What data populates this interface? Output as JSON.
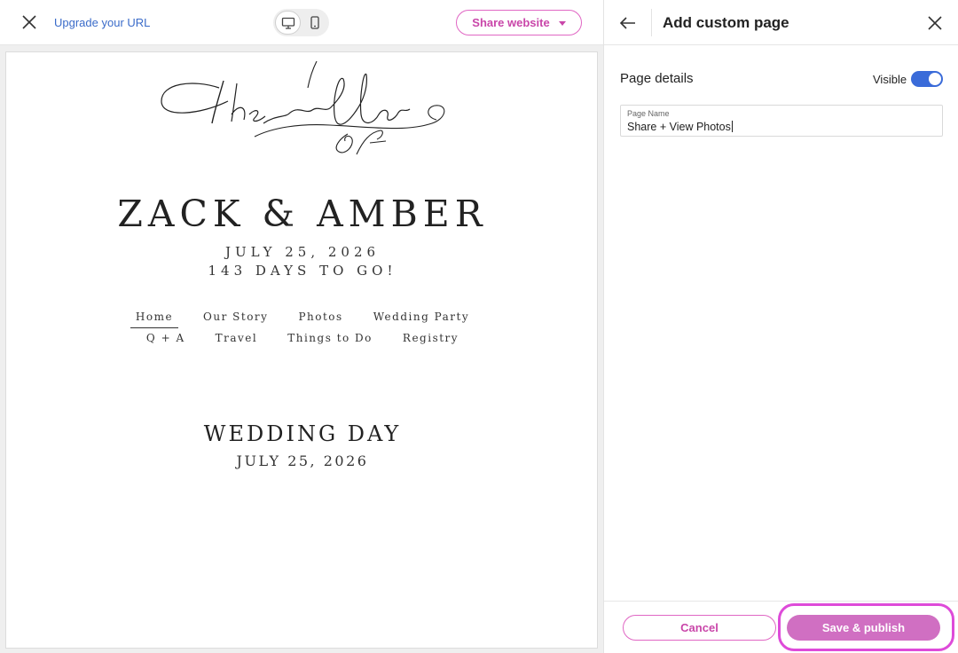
{
  "topbar": {
    "upgrade_link": "Upgrade your URL",
    "share_label": "Share website",
    "device_modes": [
      "desktop-icon",
      "mobile-icon"
    ],
    "accent_color": "#c946a9"
  },
  "preview": {
    "logo_text": "the wedding of",
    "couple": "ZACK & AMBER",
    "date": "JULY 25, 2026",
    "countdown": "143 DAYS TO GO!",
    "nav_row1": [
      "Home",
      "Our Story",
      "Photos",
      "Wedding Party"
    ],
    "nav_row2": [
      "Q + A",
      "Travel",
      "Things to Do",
      "Registry"
    ],
    "active_nav": "Home",
    "section_title": "WEDDING DAY",
    "section_date": "JULY 25, 2026"
  },
  "panel": {
    "title": "Add custom page",
    "section_label": "Page details",
    "visible_label": "Visible",
    "visible_on": true,
    "field_label": "Page Name",
    "field_value": "Share + View Photos",
    "cancel_label": "Cancel",
    "save_label": "Save & publish",
    "toggle_color": "#3a6bd9",
    "save_color": "#d06fc2"
  }
}
